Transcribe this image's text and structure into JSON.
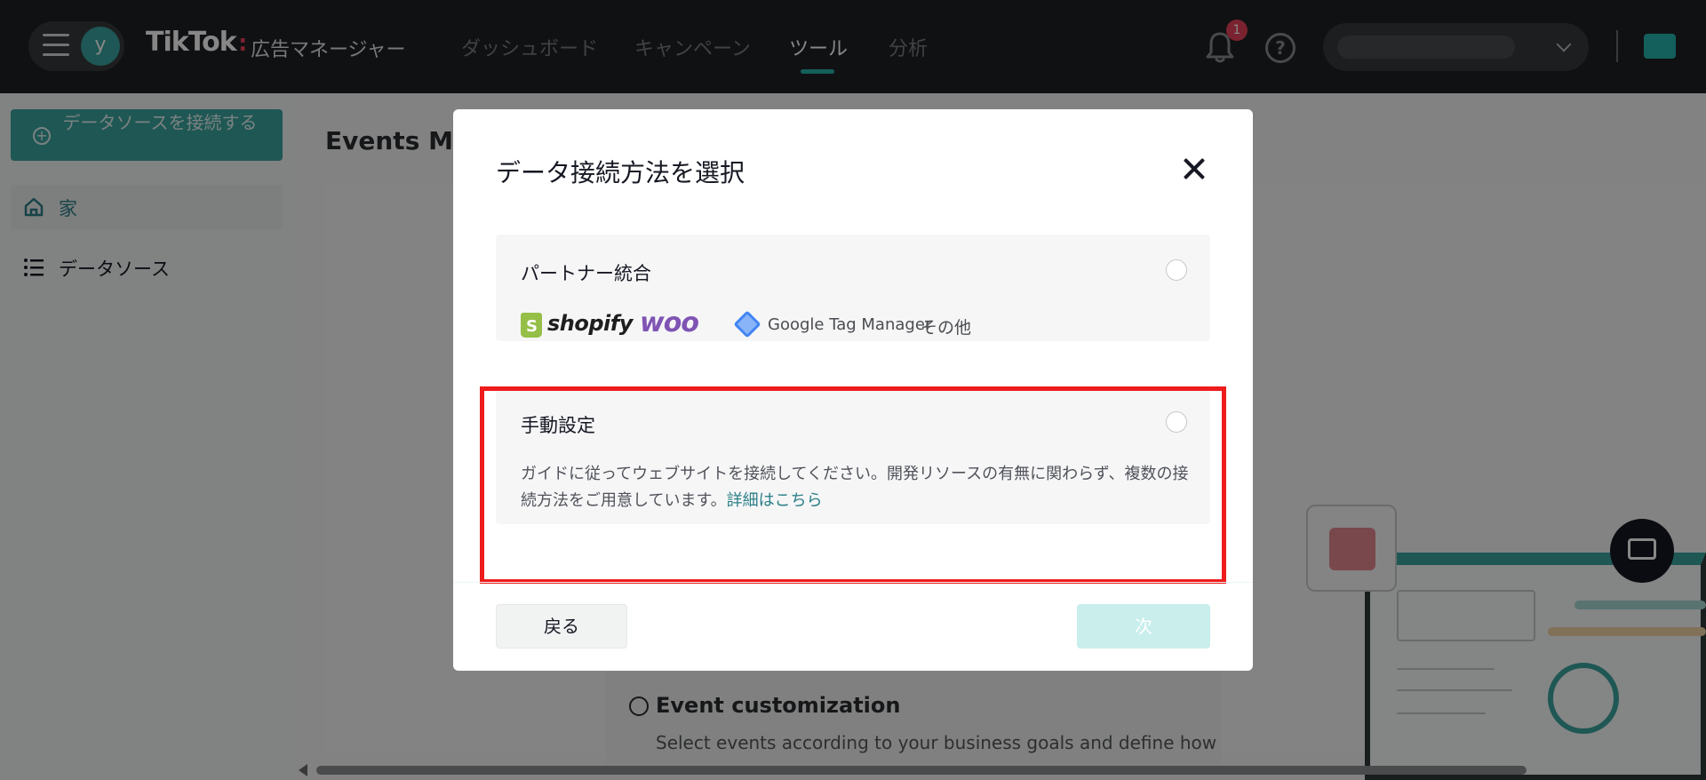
{
  "app": {
    "brand": "TikTok",
    "brand_separator": ":",
    "brand_sub": "広告マネージャー",
    "avatar_initial": "y"
  },
  "nav": {
    "items": [
      {
        "label": "ダッシュボード",
        "active": false
      },
      {
        "label": "キャンペーン",
        "active": false
      },
      {
        "label": "ツール",
        "active": true
      },
      {
        "label": "分析",
        "active": false
      }
    ],
    "notification_count": "1",
    "help_glyph": "?"
  },
  "sidebar": {
    "connect_button": "データソースを接続する",
    "items": [
      {
        "label": "家",
        "icon": "home-icon",
        "active": true
      },
      {
        "label": "データソース",
        "icon": "list-icon",
        "active": false
      }
    ]
  },
  "main": {
    "title": "Events Ma",
    "feature_title": "Event customization",
    "feature_desc": "Select events according to your business goals and define how"
  },
  "modal": {
    "title": "データ接続方法を選択",
    "options": [
      {
        "title": "パートナー統合",
        "logos": [
          "shopify",
          "woo",
          "Google Tag Manager"
        ],
        "other": "その他"
      },
      {
        "title": "手動設定",
        "desc": "ガイドに従ってウェブサイトを接続してください。開発リソースの有無に関わらず、複数の接続方法をご用意しています。",
        "link": "詳細はこちら"
      }
    ],
    "back_button": "戻る",
    "next_button": "次"
  },
  "colors": {
    "accent": "#27b6ae",
    "primary_button": "#3aa59f",
    "highlight_border": "#ee1c1c",
    "badge": "#e8405b"
  }
}
